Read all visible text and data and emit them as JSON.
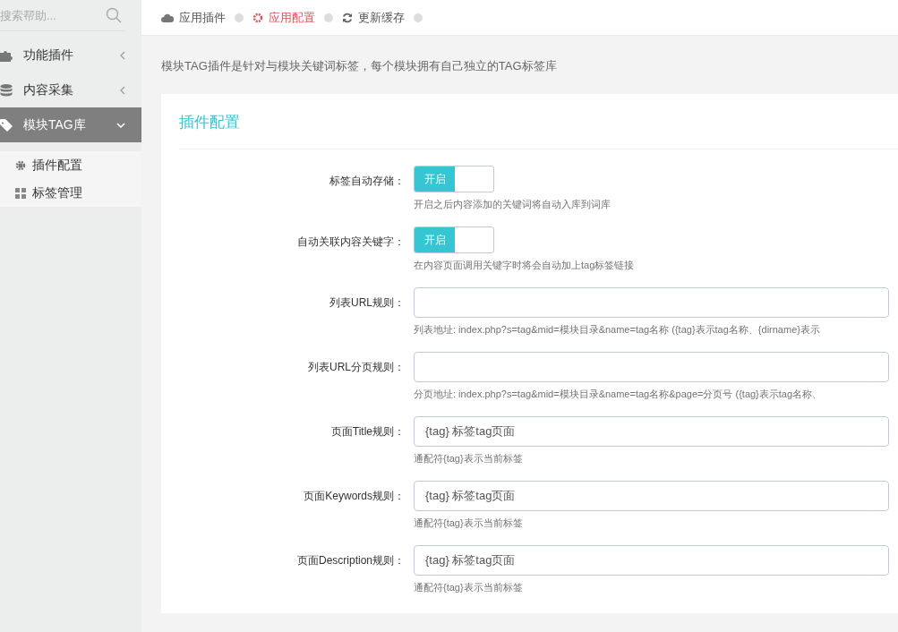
{
  "sidebar": {
    "search": {
      "placeholder": "搜索帮助..."
    },
    "items": [
      {
        "label": "功能插件",
        "expanded": false,
        "selected": false
      },
      {
        "label": "内容采集",
        "expanded": false,
        "selected": false
      },
      {
        "label": "模块TAG库",
        "expanded": true,
        "selected": true,
        "children": [
          {
            "label": "插件配置",
            "selected": false
          },
          {
            "label": "标签管理",
            "selected": false
          }
        ]
      }
    ]
  },
  "breadcrumb": [
    {
      "label": "应用插件",
      "selected": false
    },
    {
      "label": "应用配置",
      "selected": true
    },
    {
      "label": "更新缓存",
      "selected": false
    }
  ],
  "description": "模块TAG插件是针对与模块关键词标签，每个模块拥有自己独立的TAG标签库",
  "card": {
    "title": "插件配置",
    "fields": [
      {
        "kind": "toggle",
        "label": "标签自动存储：",
        "on": true,
        "on_text": "开启",
        "help": "开启之后内容添加的关键词将自动入库到词库"
      },
      {
        "kind": "toggle",
        "label": "自动关联内容关键字：",
        "on": true,
        "on_text": "开启",
        "help": "在内容页面调用关键字时将会自动加上tag标签链接"
      },
      {
        "kind": "input",
        "label": "列表URL规则：",
        "help": "列表地址: index.php?s=tag&mid=模块目录&name=tag名称 ({tag}表示tag名称、{dirname}表示"
      },
      {
        "kind": "input",
        "label": "列表URL分页规则：",
        "help": "分页地址: index.php?s=tag&mid=模块目录&name=tag名称&page=分页号 ({tag}表示tag名称、"
      },
      {
        "kind": "input",
        "label": "页面Title规则：",
        "value": "{tag} 标签tag页面",
        "help": "通配符{tag}表示当前标签"
      },
      {
        "kind": "input",
        "label": "页面Keywords规则：",
        "value": "{tag} 标签tag页面",
        "help": "通配符{tag}表示当前标签"
      },
      {
        "kind": "input",
        "label": "页面Description规则：",
        "value": "{tag} 标签tag页面",
        "help": "通配符{tag}表示当前标签"
      }
    ]
  }
}
